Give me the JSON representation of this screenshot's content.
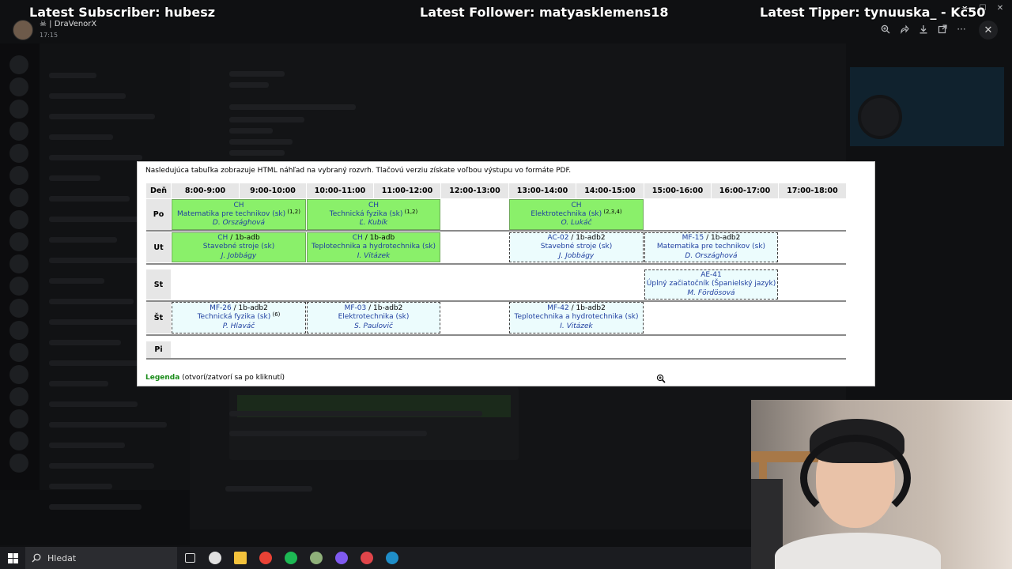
{
  "overlay": {
    "subscriber": "Latest Subscriber: hubesz",
    "follower": "Latest Follower: matyasklemens18",
    "tipper": "Latest Tipper: tynuuska_ - Kč50"
  },
  "viewer": {
    "user_name": "☠ | DraVenorX",
    "time": "17:15",
    "tools": [
      "zoom-in-icon",
      "forward-icon",
      "download-icon",
      "open-external-icon",
      "more-icon"
    ],
    "close_icon": "close-icon"
  },
  "schedule": {
    "intro": "Nasledujúca tabuľka zobrazuje HTML náhľad na vybraný rozvrh. Tlačovú verziu získate voľbou výstupu vo formáte PDF.",
    "day_header": "Deň",
    "times": [
      "8:00-9:00",
      "9:00-10:00",
      "10:00-11:00",
      "11:00-12:00",
      "12:00-13:00",
      "13:00-14:00",
      "14:00-15:00",
      "15:00-16:00",
      "16:00-17:00",
      "17:00-18:00"
    ],
    "days": [
      "Po",
      "Ut",
      "St",
      "Št",
      "Pi"
    ],
    "cells": [
      {
        "day": 0,
        "slot": 0,
        "span": 2,
        "kind": "green",
        "line1": "CH",
        "group": "",
        "course": "Matematika pre technikov (sk)",
        "sup": "(1,2)",
        "teacher": "D. Országhová"
      },
      {
        "day": 0,
        "slot": 2,
        "span": 2,
        "kind": "green",
        "line1": "CH",
        "group": "",
        "course": "Technická fyzika (sk)",
        "sup": "(1,2)",
        "teacher": "Ľ. Kubík"
      },
      {
        "day": 0,
        "slot": 5,
        "span": 2,
        "kind": "green",
        "line1": "CH",
        "group": "",
        "course": "Elektrotechnika (sk)",
        "sup": "(2,3,4)",
        "teacher": "O. Lukáč"
      },
      {
        "day": 1,
        "slot": 0,
        "span": 2,
        "kind": "green",
        "line1": "CH",
        "group": "1b-adb",
        "course": "Stavebné stroje (sk)",
        "sup": "",
        "teacher": "J. Jobbágy"
      },
      {
        "day": 1,
        "slot": 2,
        "span": 2,
        "kind": "green",
        "line1": "CH",
        "group": "1b-adb",
        "course": "Teplotechnika a hydrotechnika (sk)",
        "sup": "",
        "teacher": "I. Vitázek"
      },
      {
        "day": 1,
        "slot": 5,
        "span": 2,
        "kind": "blue",
        "line1": "AC-02",
        "group": "1b-adb2",
        "course": "Stavebné stroje (sk)",
        "sup": "",
        "teacher": "J. Jobbágy"
      },
      {
        "day": 1,
        "slot": 7,
        "span": 2,
        "kind": "blue",
        "line1": "MF-15",
        "group": "1b-adb2",
        "course": "Matematika pre technikov (sk)",
        "sup": "",
        "teacher": "D. Országhová"
      },
      {
        "day": 2,
        "slot": 7,
        "span": 2,
        "kind": "blue",
        "line1": "AE-41",
        "group": "",
        "course": "Úplný začiatočník (Španielský jazyk)",
        "sup": "",
        "teacher": "M. Fördösová"
      },
      {
        "day": 3,
        "slot": 0,
        "span": 2,
        "kind": "blue",
        "line1": "MF-26",
        "group": "1b-adb2",
        "course": "Technická fyzika (sk)",
        "sup": "(6)",
        "teacher": "P. Hlaváč"
      },
      {
        "day": 3,
        "slot": 2,
        "span": 2,
        "kind": "blue",
        "line1": "MF-03",
        "group": "1b-adb2",
        "course": "Elektrotechnika (sk)",
        "sup": "",
        "teacher": "S. Paulovič"
      },
      {
        "day": 3,
        "slot": 5,
        "span": 2,
        "kind": "blue",
        "line1": "MF-42",
        "group": "1b-adb2",
        "course": "Teplotechnika a hydrotechnika (sk)",
        "sup": "",
        "teacher": "I. Vitázek"
      }
    ],
    "legend_link": "Legenda",
    "legend_hint": "(otvorí/zatvorí sa po kliknutí)"
  },
  "taskbar": {
    "search_placeholder": "Hledat",
    "apps": [
      {
        "name": "task-view-icon",
        "color": "#2b2c30"
      },
      {
        "name": "app-icon-1",
        "color": "#e0e0e0"
      },
      {
        "name": "file-explorer-icon",
        "color": "#f3c23c"
      },
      {
        "name": "chrome-icon",
        "color": "#e94235"
      },
      {
        "name": "spotify-icon",
        "color": "#1db954"
      },
      {
        "name": "app-icon-2",
        "color": "#8fb07a"
      },
      {
        "name": "discord-icon",
        "color": "#7f5af0"
      },
      {
        "name": "app-icon-3",
        "color": "#e0454a"
      },
      {
        "name": "steam-icon",
        "color": "#1f8ec9"
      }
    ]
  }
}
